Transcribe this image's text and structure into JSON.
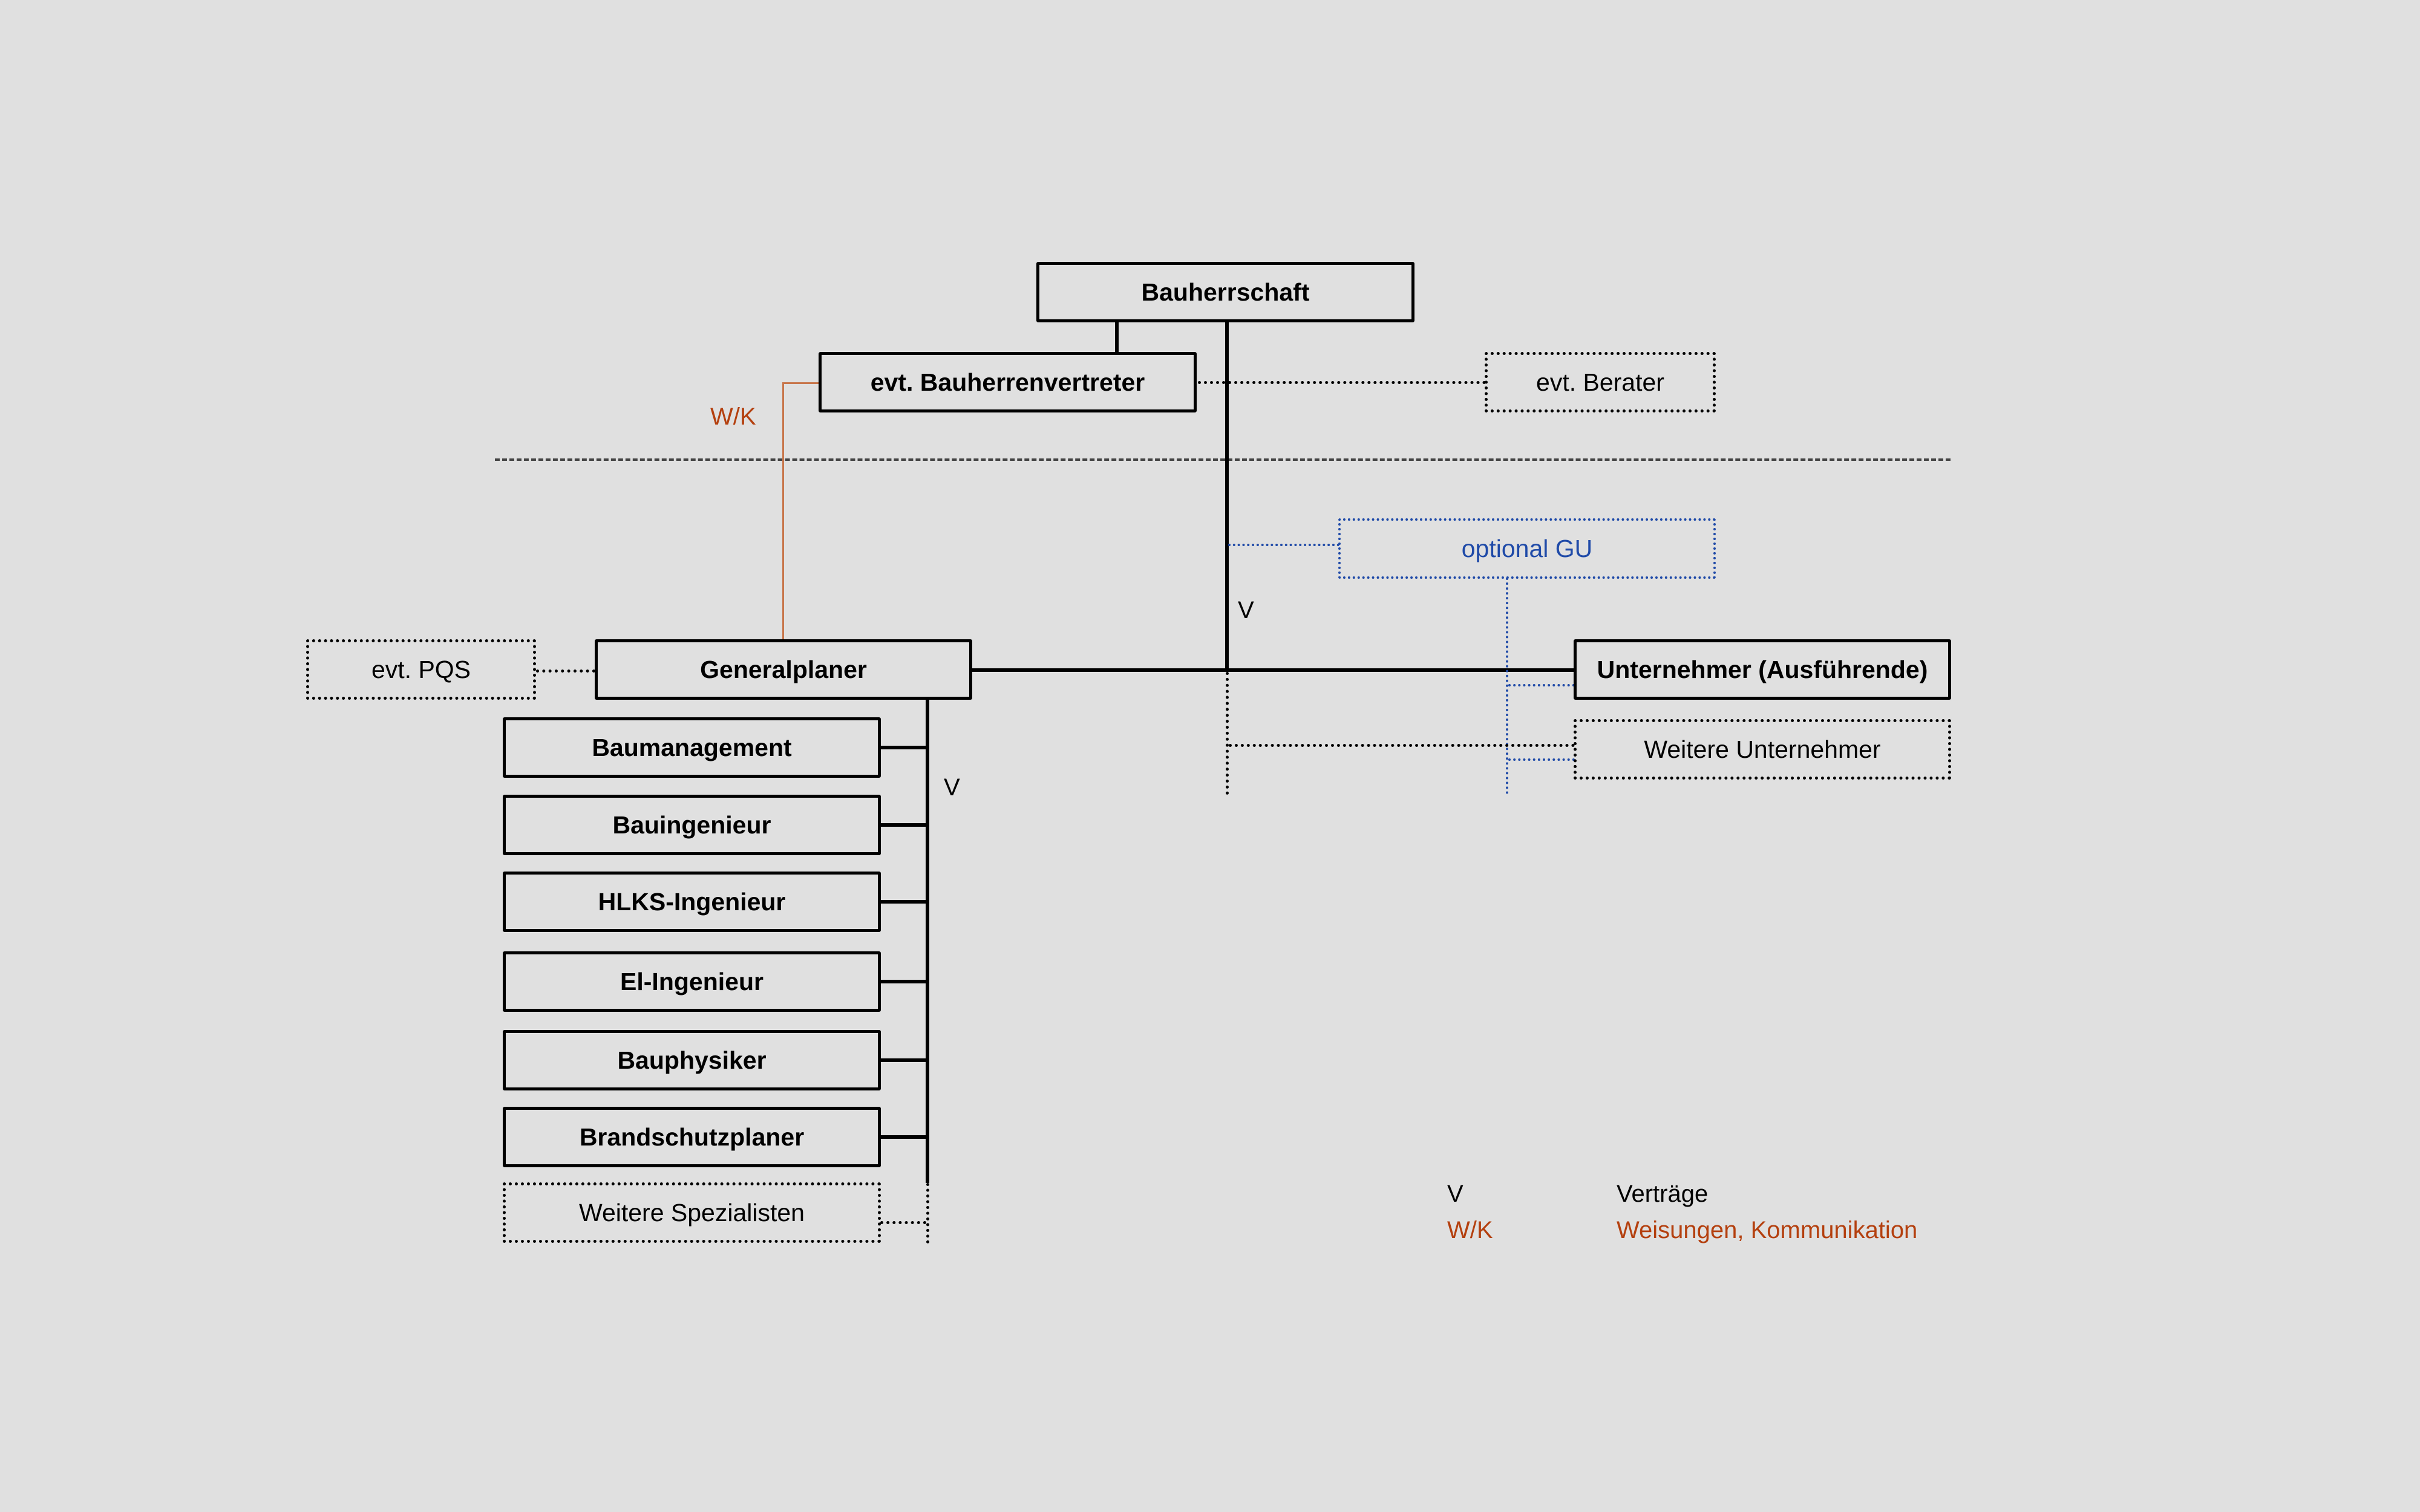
{
  "nodes": {
    "bauherrschaft": "Bauherrschaft",
    "bauherrenvertreter": "evt. Bauherrenvertreter",
    "berater": "evt. Berater",
    "optional_gu": "optional GU",
    "pqs": "evt. PQS",
    "generalplaner": "Generalplaner",
    "unternehmer": "Unternehmer (Ausführende)",
    "weitere_unternehmer": "Weitere Unternehmer",
    "specialists": [
      "Baumanagement",
      "Bauingenieur",
      "HLKS-Ingenieur",
      "El-Ingenieur",
      "Bauphysiker",
      "Brandschutzplaner"
    ],
    "weitere_spezialisten": "Weitere Spezialisten"
  },
  "edge_labels": {
    "wk": "W/K",
    "v_main": "V",
    "v_planner": "V"
  },
  "legend": [
    {
      "key": "V",
      "label": "Verträge",
      "color": "#000000"
    },
    {
      "key": "W/K",
      "label": "Weisungen, Kommunikation",
      "color": "#b4400f"
    }
  ],
  "colors": {
    "background": "#e0e0e0",
    "contract_line": "#000000",
    "instruction_line": "#c8764b",
    "optional_gu": "#1f4aa8"
  }
}
